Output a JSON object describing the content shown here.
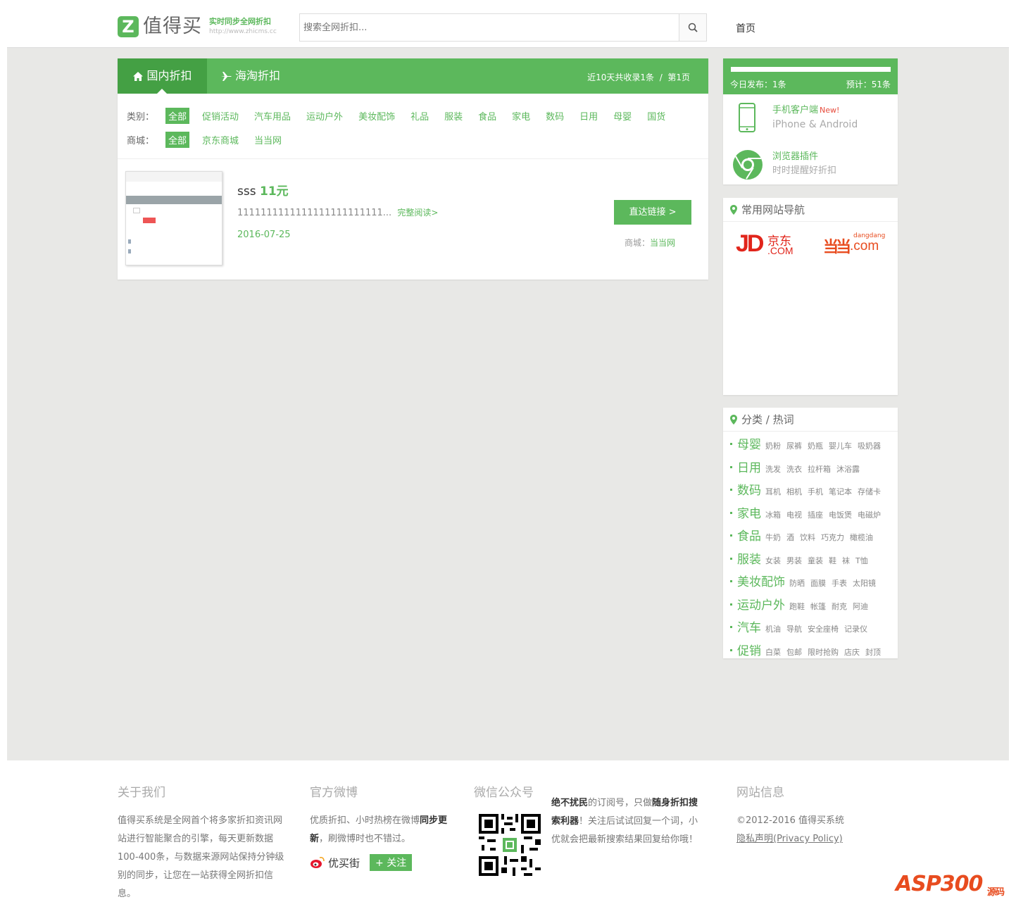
{
  "header": {
    "logo_letter": "Z",
    "logo_text": "值得买",
    "slogan": "实时同步全网折扣",
    "slogan_url": "http://www.zhicms.cc",
    "search_placeholder": "搜索全网折扣...",
    "nav_home": "首页"
  },
  "tabs": {
    "domestic": "国内折扣",
    "overseas": "海淘折扣",
    "info": "近10天共收录1条  /  第1页"
  },
  "filters": {
    "category_label": "类别：",
    "categories": [
      "全部",
      "促销活动",
      "汽车用品",
      "运动户外",
      "美妆配饰",
      "礼品",
      "服装",
      "食品",
      "家电",
      "数码",
      "日用",
      "母婴",
      "国货"
    ],
    "store_label": "商城：",
    "stores": [
      "全部",
      "京东商城",
      "当当网"
    ]
  },
  "item": {
    "title": "sss",
    "price": "11元",
    "desc": "1111111111111111111111111...",
    "more": "完整阅读>",
    "date": "2016-07-25",
    "button": "直达链接 >",
    "store_label": "商城：",
    "store": "当当网"
  },
  "sidebar": {
    "today": "今日发布：1条",
    "forecast": "预计：51条",
    "app_title": "手机客户端",
    "app_new": "New!",
    "app_desc": "iPhone & Android",
    "plugin_title": "浏览器插件",
    "plugin_desc": "时时提醒好折扣",
    "nav_title": "常用网站导航",
    "jd_logo": "JD.COM",
    "jd_cn": "京东",
    "dd_logo": "当当",
    "dd_sub": "dangdang",
    "dd_com": ".com",
    "tags_title": "分类 / 热词",
    "tag_rows": [
      {
        "cat": "母婴",
        "kws": [
          "奶粉",
          "尿裤",
          "奶瓶",
          "婴儿车",
          "吸奶器"
        ]
      },
      {
        "cat": "日用",
        "kws": [
          "洗发",
          "洗衣",
          "拉杆箱",
          "沐浴露"
        ]
      },
      {
        "cat": "数码",
        "kws": [
          "耳机",
          "相机",
          "手机",
          "笔记本",
          "存储卡"
        ]
      },
      {
        "cat": "家电",
        "kws": [
          "冰箱",
          "电视",
          "插座",
          "电饭煲",
          "电磁炉"
        ]
      },
      {
        "cat": "食品",
        "kws": [
          "牛奶",
          "酒",
          "饮料",
          "巧克力",
          "橄榄油"
        ]
      },
      {
        "cat": "服装",
        "kws": [
          "女装",
          "男装",
          "童装",
          "鞋",
          "袜",
          "T恤"
        ]
      },
      {
        "cat": "美妆配饰",
        "kws": [
          "防晒",
          "面膜",
          "手表",
          "太阳镜"
        ]
      },
      {
        "cat": "运动户外",
        "kws": [
          "跑鞋",
          "帐篷",
          "耐克",
          "阿迪"
        ]
      },
      {
        "cat": "汽车",
        "kws": [
          "机油",
          "导航",
          "安全座椅",
          "记录仪"
        ]
      },
      {
        "cat": "促销",
        "kws": [
          "白菜",
          "包邮",
          "限时抢购",
          "店庆",
          "封顶"
        ]
      }
    ]
  },
  "footer": {
    "about_title": "关于我们",
    "about_text": "值得买系统是全网首个将多家折扣资讯网站进行智能聚合的引擎，每天更新数据100-400条，与数据来源网站保持分钟级别的同步，让您在一站获得全网折扣信息。",
    "weibo_title": "官方微博",
    "weibo_text_1": "优质折扣、小时热榜在微博",
    "weibo_text_b": "同步更新",
    "weibo_text_2": "，刷微博时也不错过。",
    "weibo_name": "优买街",
    "weibo_follow": "+ 关注",
    "wechat_title": "微信公众号",
    "wechat_b1": "绝不扰民",
    "wechat_t1": "的订阅号，只做",
    "wechat_b2": "随身折扣搜索利器",
    "wechat_t2": "！关注后试试回复一个词，小优就会把最新搜索结果回复给你哦！",
    "info_title": "网站信息",
    "copyright": "©2012-2016 值得买系统",
    "privacy": "隐私声明(Privacy Policy)"
  },
  "watermark": {
    "text": "ASP300",
    "sub": "源码"
  },
  "colors": {
    "accent": "#5cb85c",
    "accent_dark": "#44a044",
    "background": "#e8e8e6"
  }
}
